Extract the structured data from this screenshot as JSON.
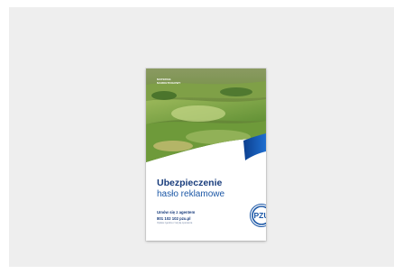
{
  "flyer": {
    "tag": "MATERIAŁ MARKETINGOWY",
    "headline": "Ubezpieczenie",
    "subline": "hasło reklamowe",
    "cta": "Umów się z agentem",
    "phone": "801 102 102 pzu.pl",
    "fee": "Opłata zgodna z taryfą operatora",
    "logo_text": "PZU",
    "image": "landscape-fields"
  },
  "colors": {
    "background": "#eeeeee",
    "brand_navy": "#183c7c",
    "brand_blue": "#1b57a6"
  }
}
